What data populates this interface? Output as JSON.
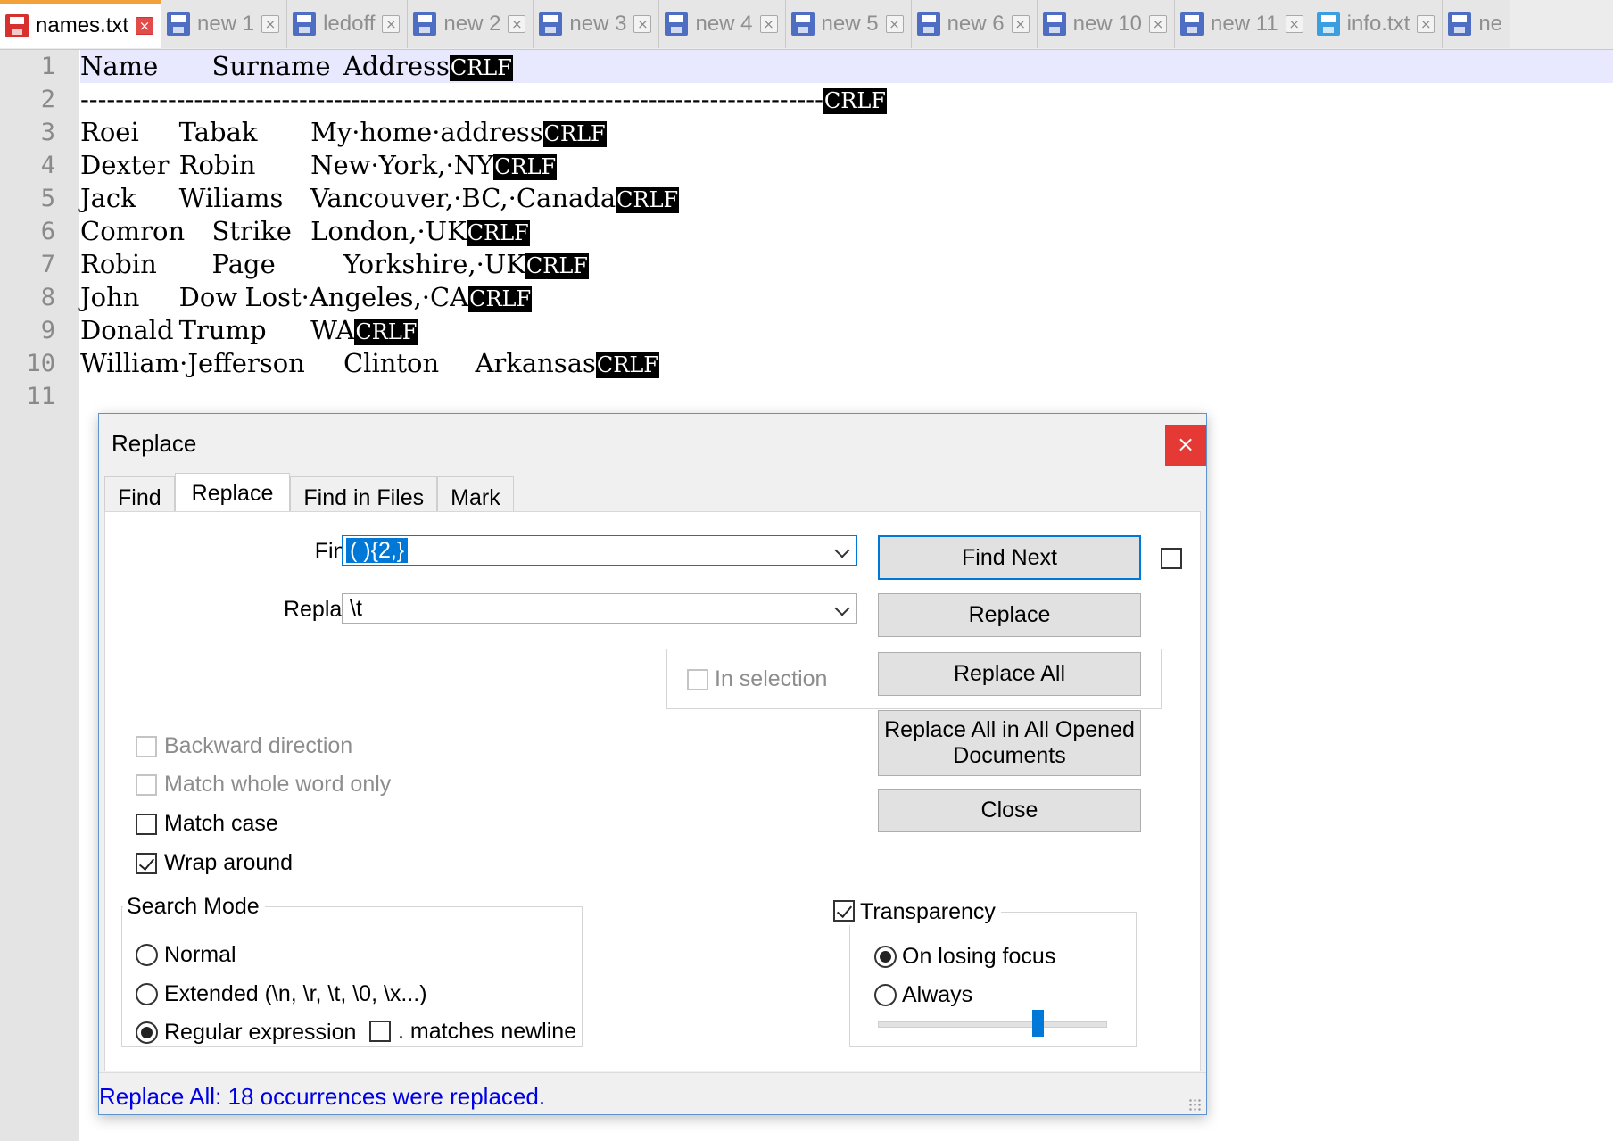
{
  "tabs": [
    {
      "name": "names.txt",
      "active": true,
      "icon": "disk-red-icon"
    },
    {
      "name": "new 1",
      "icon": "disk-blue-icon"
    },
    {
      "name": "ledoff",
      "icon": "disk-blue-icon"
    },
    {
      "name": "new 2",
      "icon": "disk-blue-icon"
    },
    {
      "name": "new 3",
      "icon": "disk-blue-icon"
    },
    {
      "name": "new 4",
      "icon": "disk-blue-icon"
    },
    {
      "name": "new 5",
      "icon": "disk-blue-icon"
    },
    {
      "name": "new 6",
      "icon": "disk-blue-icon"
    },
    {
      "name": "new 10",
      "icon": "disk-blue-icon"
    },
    {
      "name": "new 11",
      "icon": "disk-blue-icon"
    },
    {
      "name": "info.txt",
      "icon": "disk-cyan-icon"
    },
    {
      "name": "ne",
      "icon": "disk-blue-icon"
    }
  ],
  "editor": {
    "line_numbers": [
      "1",
      "2",
      "3",
      "4",
      "5",
      "6",
      "7",
      "8",
      "9",
      "10",
      "11"
    ],
    "eol_marker": "CRLF",
    "lines": [
      "Name\t\tSurname\tAddress",
      "-------------------------------------------------------------------------------------",
      "Roei\t\tTabak\t\tMy·home·address",
      "Dexter\tRobin\t\tNew·York,·NY",
      "Jack\t\tWiliams\tVancouver,·BC,·Canada",
      "Comron\tStrike\tLondon,·UK",
      "Robin\t\tPage\t\tYorkshire,·UK",
      "John\t\tDow\tLost·Angeles,·CA",
      "Donald\tTrump\t\tWA",
      "William·Jefferson\t\tClinton\tArkansas",
      ""
    ]
  },
  "dialog": {
    "title": "Replace",
    "close_glyph": "×",
    "tabs": [
      "Find",
      "Replace",
      "Find in Files",
      "Mark"
    ],
    "find_label": "Find what :",
    "find_value": "( ){2,}",
    "replace_label": "Replace with :",
    "replace_value": "\\t",
    "buttons": {
      "find_next": "Find Next",
      "replace": "Replace",
      "replace_all": "Replace All",
      "replace_all_opened": "Replace All in All Opened Documents",
      "close": "Close"
    },
    "in_selection": "In selection",
    "options": {
      "backward": "Backward direction",
      "whole_word": "Match whole word only",
      "match_case": "Match case",
      "wrap_around": "Wrap around"
    },
    "search_mode": {
      "title": "Search Mode",
      "normal": "Normal",
      "extended": "Extended (\\n, \\r, \\t, \\0, \\x...)",
      "regex": "Regular expression",
      "dot_newline": ". matches newline"
    },
    "transparency": {
      "title": "Transparency",
      "on_losing_focus": "On losing focus",
      "always": "Always",
      "level": 0.7
    },
    "status": "Replace All: 18 occurrences were replaced."
  }
}
